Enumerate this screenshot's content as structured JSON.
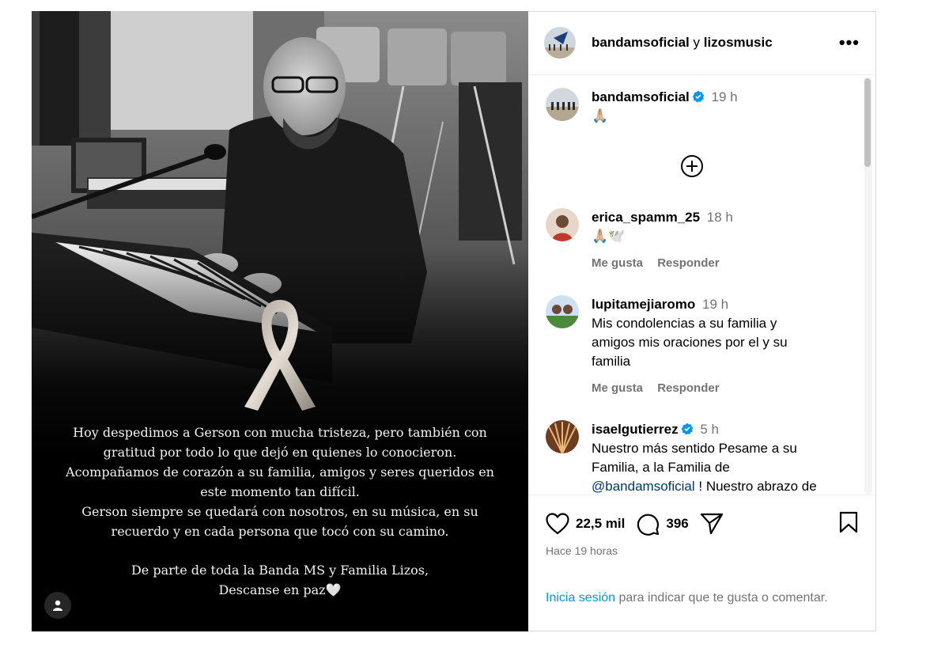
{
  "colors": {
    "link": "#0095f6",
    "verified": "#0095f6",
    "secondary": "#737373",
    "mention": "#00376b"
  },
  "header": {
    "account_a": "bandamsoficial",
    "joiner": "y",
    "account_b": "lizosmusic",
    "more_icon": "more-horizontal-icon"
  },
  "media": {
    "tribute_lines": [
      "Hoy despedimos a Gerson con mucha tristeza, pero también con",
      "gratitud por todo lo que dejó en quienes lo conocieron.",
      "Acompañamos de corazón a su familia, amigos y seres queridos en",
      "este momento tan difícil.",
      "Gerson siempre se quedará con nosotros, en su música, en su",
      "recuerdo y en cada persona que tocó con su camino."
    ],
    "signoff_lines": [
      "De parte de toda la Banda MS y Familia Lizos,",
      "Descanse en paz🤍"
    ]
  },
  "caption": {
    "user": "bandamsoficial",
    "time": "19 h",
    "text": "🙏🏼"
  },
  "comments": [
    {
      "user": "erica_spamm_25",
      "verified": false,
      "time": "18 h",
      "text": "🙏🏼🕊️",
      "like": "Me gusta",
      "reply": "Responder"
    },
    {
      "user": "lupitamejiaromo",
      "verified": false,
      "time": "19 h",
      "text_lines": [
        "Mis condolencias a su familia y",
        "amigos mis oraciones por el y su",
        "familia"
      ],
      "like": "Me gusta",
      "reply": "Responder"
    },
    {
      "user": "isaelgutierrez",
      "verified": true,
      "time": "5 h",
      "text_lines": [
        "Nuestro más sentido Pesame a su",
        "Familia, a la Familia de"
      ],
      "mention": "@bandamsoficial",
      "after_mention": " ! Nuestro abrazo de"
    }
  ],
  "stats": {
    "likes": "22,5 mil",
    "comments": "396",
    "time_ago": "Hace 19 horas"
  },
  "login": {
    "link": "Inicia sesión",
    "rest": " para indicar que te gusta o comentar."
  }
}
